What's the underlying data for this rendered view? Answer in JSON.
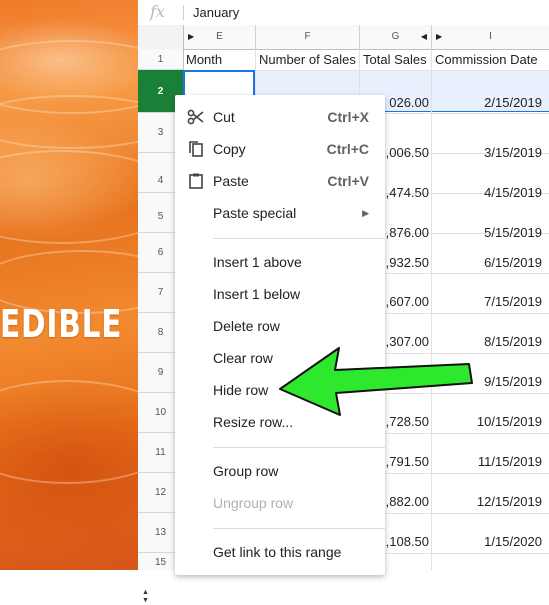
{
  "background": {
    "overlay_word": "EDIBLE"
  },
  "formula_bar": {
    "fx_label": "fx",
    "value": "January"
  },
  "columns": [
    {
      "letter": "E",
      "header": "Month"
    },
    {
      "letter": "F",
      "header": "Number of Sales"
    },
    {
      "letter": "G",
      "header": "Total Sales"
    },
    {
      "letter": "I",
      "header": "Commission Date"
    }
  ],
  "rows": [
    {
      "num": "1"
    },
    {
      "num": "2",
      "total": "026.00",
      "date": "2/15/2019"
    },
    {
      "num": "3",
      "total": ",006.50",
      "date": "3/15/2019"
    },
    {
      "num": "4",
      "total": ",474.50",
      "date": "4/15/2019"
    },
    {
      "num": "5",
      "total": ",876.00",
      "date": "5/15/2019"
    },
    {
      "num": "6",
      "total": ",932.50",
      "date": "6/15/2019"
    },
    {
      "num": "7",
      "total": ",607.00",
      "date": "7/15/2019"
    },
    {
      "num": "8",
      "total": ",307.00",
      "date": "8/15/2019"
    },
    {
      "num": "9",
      "total": "",
      "date": "9/15/2019"
    },
    {
      "num": "10",
      "total": ",728.50",
      "date": "10/15/2019"
    },
    {
      "num": "11",
      "total": ",791.50",
      "date": "11/15/2019"
    },
    {
      "num": "12",
      "total": ",882.00",
      "date": "12/15/2019"
    },
    {
      "num": "13",
      "total": ",108.50",
      "date": "1/15/2020"
    },
    {
      "num": "15"
    }
  ],
  "context_menu": {
    "cut": {
      "label": "Cut",
      "shortcut": "Ctrl+X"
    },
    "copy": {
      "label": "Copy",
      "shortcut": "Ctrl+C"
    },
    "paste": {
      "label": "Paste",
      "shortcut": "Ctrl+V"
    },
    "paste_special": {
      "label": "Paste special"
    },
    "insert_above": "Insert 1 above",
    "insert_below": "Insert 1 below",
    "delete_row": "Delete row",
    "clear_row": "Clear row",
    "hide_row": "Hide row",
    "resize_row": "Resize row...",
    "group_row": "Group row",
    "ungroup_row": "Ungroup row",
    "get_link": "Get link to this range"
  },
  "colors": {
    "accent": "#1a73e8",
    "selected_row": "#1a7f37",
    "arrow": "#2ee82e"
  }
}
